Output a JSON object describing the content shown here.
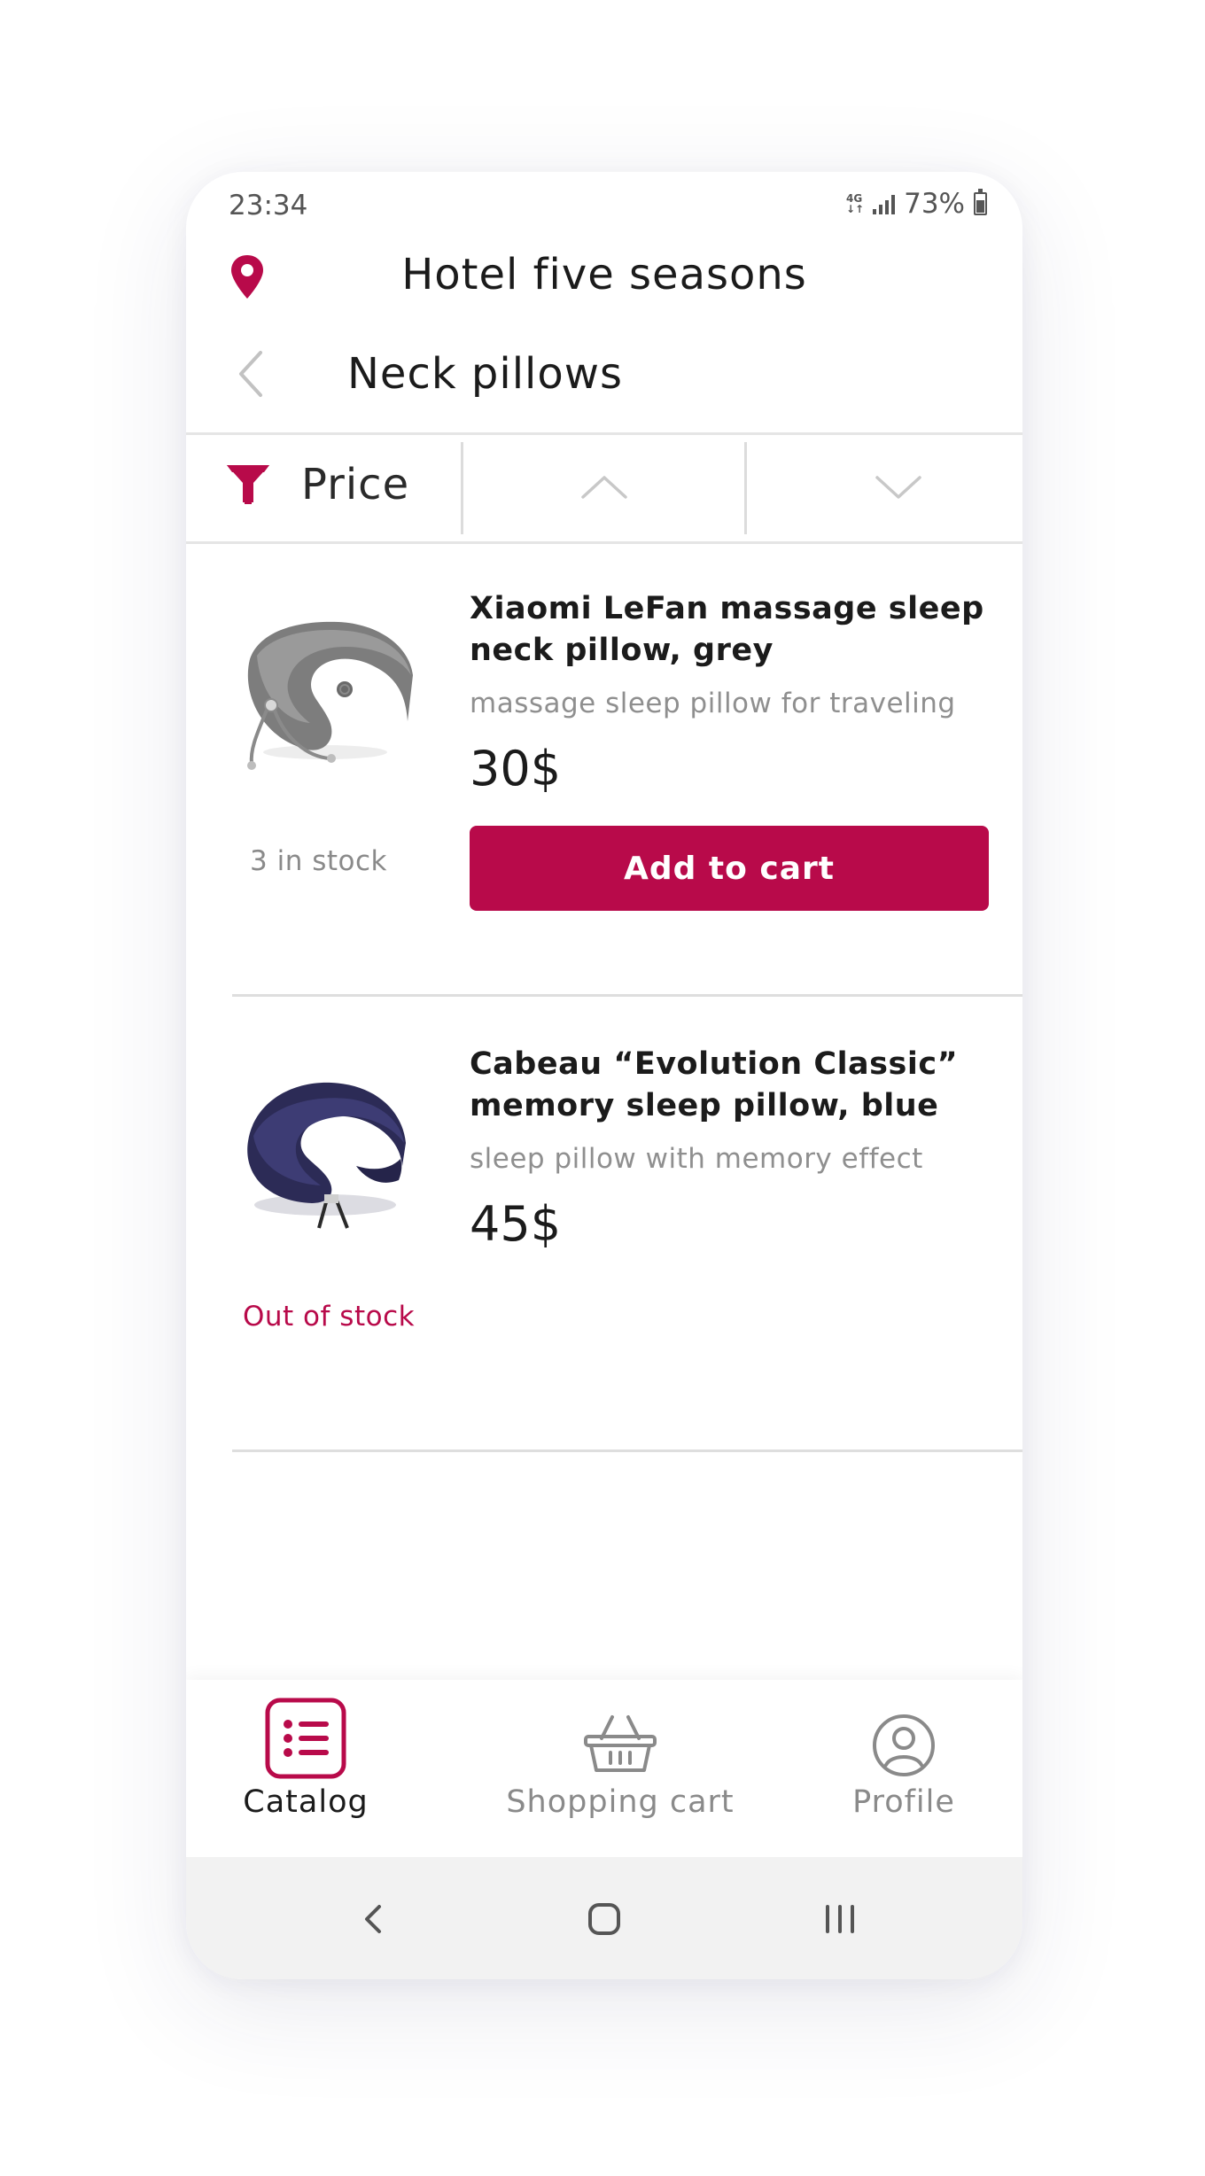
{
  "status_bar": {
    "time": "23:34",
    "network": "4G",
    "battery": "73%",
    "battery_level": 0.73
  },
  "header": {
    "hotel_name": "Hotel five seasons",
    "page_title": "Neck pillows"
  },
  "filter": {
    "label": "Price"
  },
  "products": [
    {
      "name": "Xiaomi LeFan massage sleep neck pillow, grey",
      "description": "massage sleep pillow for traveling",
      "price": "30$",
      "stock": "3 in stock",
      "button": "Add to cart"
    },
    {
      "name": "Cabeau “Evolution Classic” memory sleep pillow, blue",
      "description": "sleep pillow with memory effect",
      "price": "45$",
      "stock": "Out of stock"
    }
  ],
  "nav": {
    "catalog": "Catalog",
    "cart": "Shopping cart",
    "profile": "Profile"
  },
  "colors": {
    "accent": "#b80a4a",
    "text": "#1b1b1b",
    "muted": "#8f8f8f",
    "divider": "#dedede"
  }
}
